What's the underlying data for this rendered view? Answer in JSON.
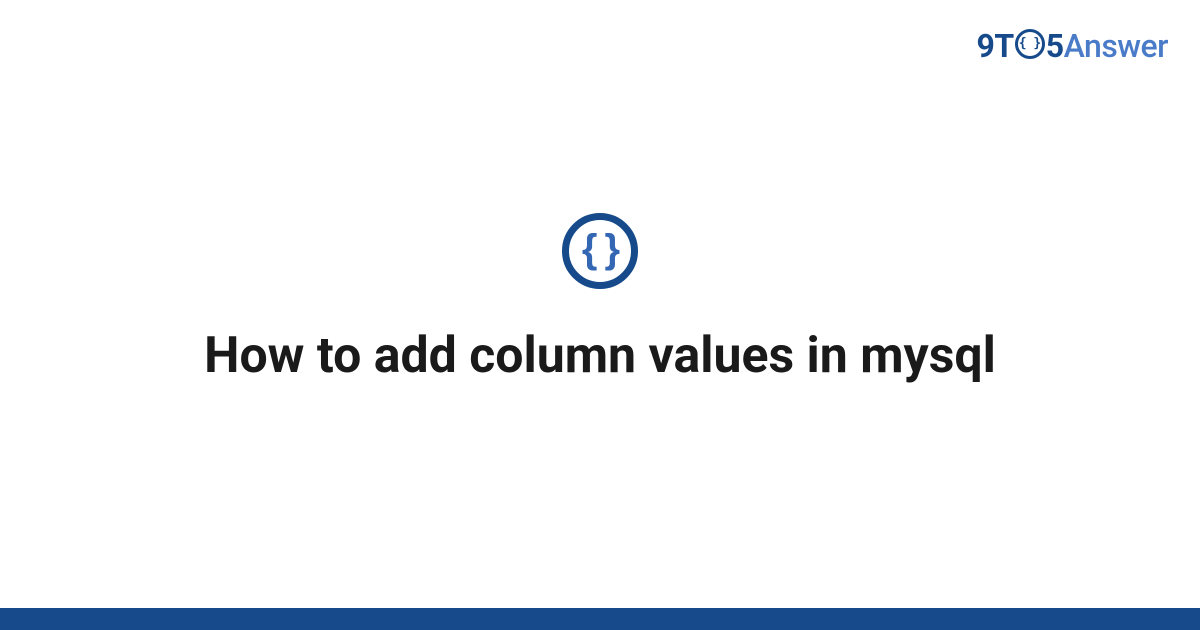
{
  "logo": {
    "part1": "9T",
    "o_inner": "{ }",
    "part2": "5",
    "part3": "Answer"
  },
  "main": {
    "icon_braces": "{ }",
    "title": "How to add column values in mysql"
  }
}
